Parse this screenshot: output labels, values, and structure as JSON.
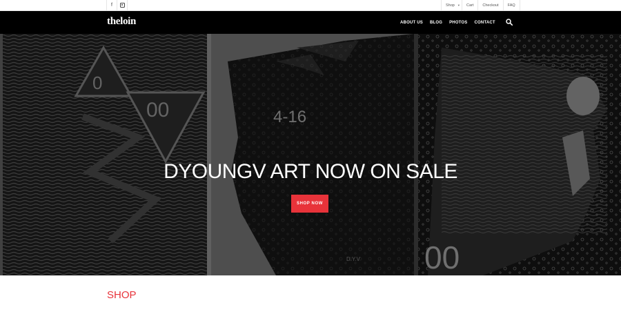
{
  "topbar": {
    "social": [
      {
        "icon": "facebook-icon",
        "glyph": "f"
      },
      {
        "icon": "instagram-icon"
      }
    ],
    "links": [
      {
        "label": "Shop",
        "has_dropdown": true
      },
      {
        "label": "Cart"
      },
      {
        "label": "Checkout"
      },
      {
        "label": "FAQ"
      }
    ]
  },
  "header": {
    "logo": "theloin",
    "nav": [
      "ABOUT US",
      "BLOG",
      "PHOTOS",
      "CONTACT"
    ],
    "search_icon": "search-icon"
  },
  "hero": {
    "title": "DYOUNGV ART NOW ON SALE",
    "cta_label": "SHOP NOW",
    "artwork_text": {
      "panel1_zero": "0",
      "panel1_double_zero": "00",
      "panel2_label": "4-16",
      "panel2_signature": "D.Y.V",
      "panel3_double_zero": "00"
    }
  },
  "main": {
    "section_title": "SHOP"
  },
  "colors": {
    "accent": "#e8333a",
    "navbar": "#000000",
    "hero_bg": "#232323"
  }
}
